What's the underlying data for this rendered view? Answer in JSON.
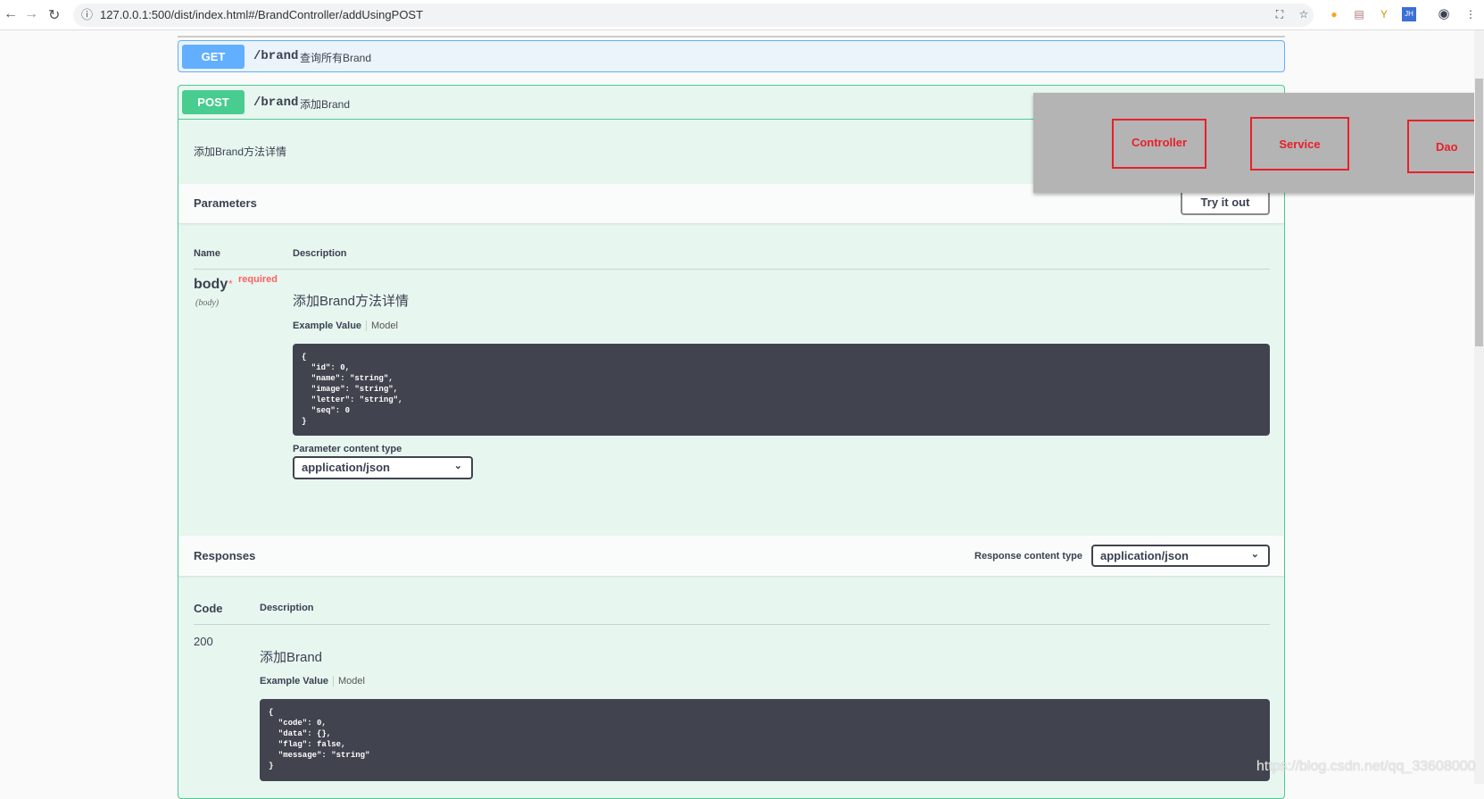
{
  "browser": {
    "url": "127.0.0.1:500/dist/index.html#/BrandController/addUsingPOST",
    "icons": [
      "back-icon",
      "forward-icon",
      "reload-icon",
      "info-icon",
      "translate-icon",
      "star-icon",
      "extension-icons",
      "account-icon",
      "menu-icon"
    ]
  },
  "get_op": {
    "method": "GET",
    "path": "/brand",
    "summary": "查询所有Brand",
    "color": "#61affe"
  },
  "post_op": {
    "method": "POST",
    "path": "/brand",
    "summary": "添加Brand",
    "color": "#49cc90",
    "description": "添加Brand方法详情",
    "parameters": {
      "title": "Parameters",
      "try_label": "Try it out",
      "col_name": "Name",
      "col_desc": "Description",
      "param": {
        "name": "body",
        "required_star": "*",
        "required": "required",
        "in": "(body)",
        "description": "添加Brand方法详情",
        "example_tab": "Example Value",
        "model_tab": "Model",
        "example": "{\n  \"id\": 0,\n  \"name\": \"string\",\n  \"image\": \"string\",\n  \"letter\": \"string\",\n  \"seq\": 0\n}"
      },
      "content_type_label": "Parameter content type",
      "content_type": "application/json"
    },
    "responses": {
      "title": "Responses",
      "content_type_label": "Response content type",
      "content_type": "application/json",
      "col_code": "Code",
      "col_desc": "Description",
      "row": {
        "code": "200",
        "description": "添加Brand",
        "example_tab": "Example Value",
        "model_tab": "Model",
        "example": "{\n  \"code\": 0,\n  \"data\": {},\n  \"flag\": false,\n  \"message\": \"string\"\n}"
      }
    }
  },
  "overlay": {
    "layers": [
      "Controller",
      "Service",
      "Dao"
    ],
    "color": "#e8202a"
  },
  "watermark": "https://blog.csdn.net/qq_33608000"
}
